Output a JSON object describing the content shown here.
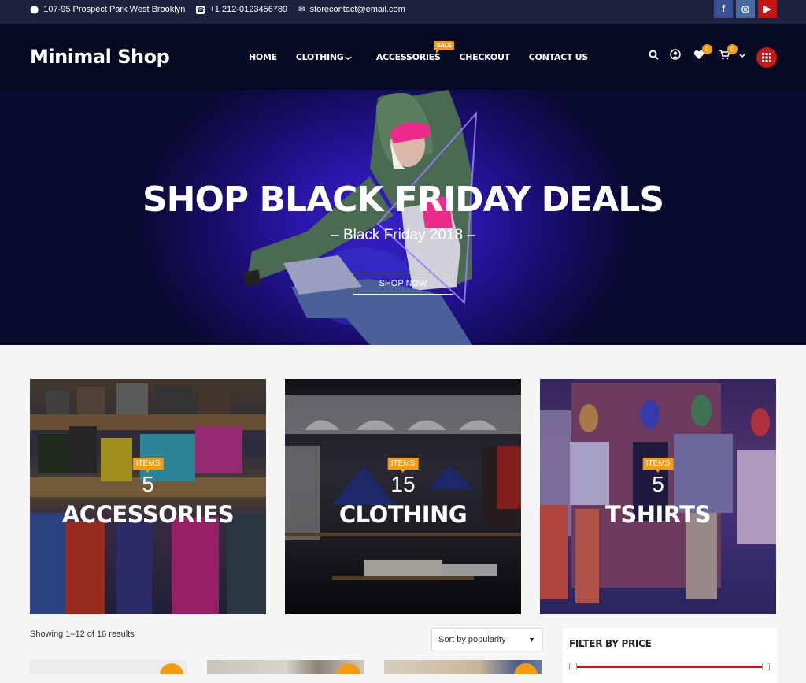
{
  "topbar": {
    "address": "107-95 Prospect Park West Brooklyn",
    "phone": "+1 212-0123456789",
    "email": "storecontact@email.com",
    "social": [
      {
        "name": "facebook",
        "glyph": "f"
      },
      {
        "name": "instagram",
        "glyph": "◎"
      },
      {
        "name": "youtube",
        "glyph": "▶"
      }
    ]
  },
  "header": {
    "logo": "Minimal Shop",
    "nav": [
      {
        "label": "HOME"
      },
      {
        "label": "CLOTHING",
        "has_dropdown": true
      },
      {
        "label": "ACCESSORIES",
        "badge": "SALE"
      },
      {
        "label": "CHECKOUT"
      },
      {
        "label": "CONTACT US"
      }
    ],
    "wishlist_count": "0",
    "cart_count": "0",
    "chevron": "⌄"
  },
  "hero": {
    "title": "SHOP BLACK FRIDAY DEALS",
    "subtitle": "– Black Friday 2018 –",
    "button": "SHOP NOW"
  },
  "categories": [
    {
      "badge": "ITEMS",
      "count": "5",
      "name": "ACCESSORIES"
    },
    {
      "badge": "ITEMS",
      "count": "15",
      "name": "CLOTHING"
    },
    {
      "badge": "ITEMS",
      "count": "5",
      "name": "TSHIRTS"
    }
  ],
  "shop": {
    "result_count": "Showing 1–12 of 16 results",
    "sort_selected": "Sort by popularity",
    "sort_arrow": "▼"
  },
  "filter": {
    "title": "FILTER BY PRICE"
  },
  "colors": {
    "accent": "#f39c12",
    "header_bg": "#050a22",
    "topbar_bg": "#1c2340",
    "brand_red": "#c71818"
  }
}
